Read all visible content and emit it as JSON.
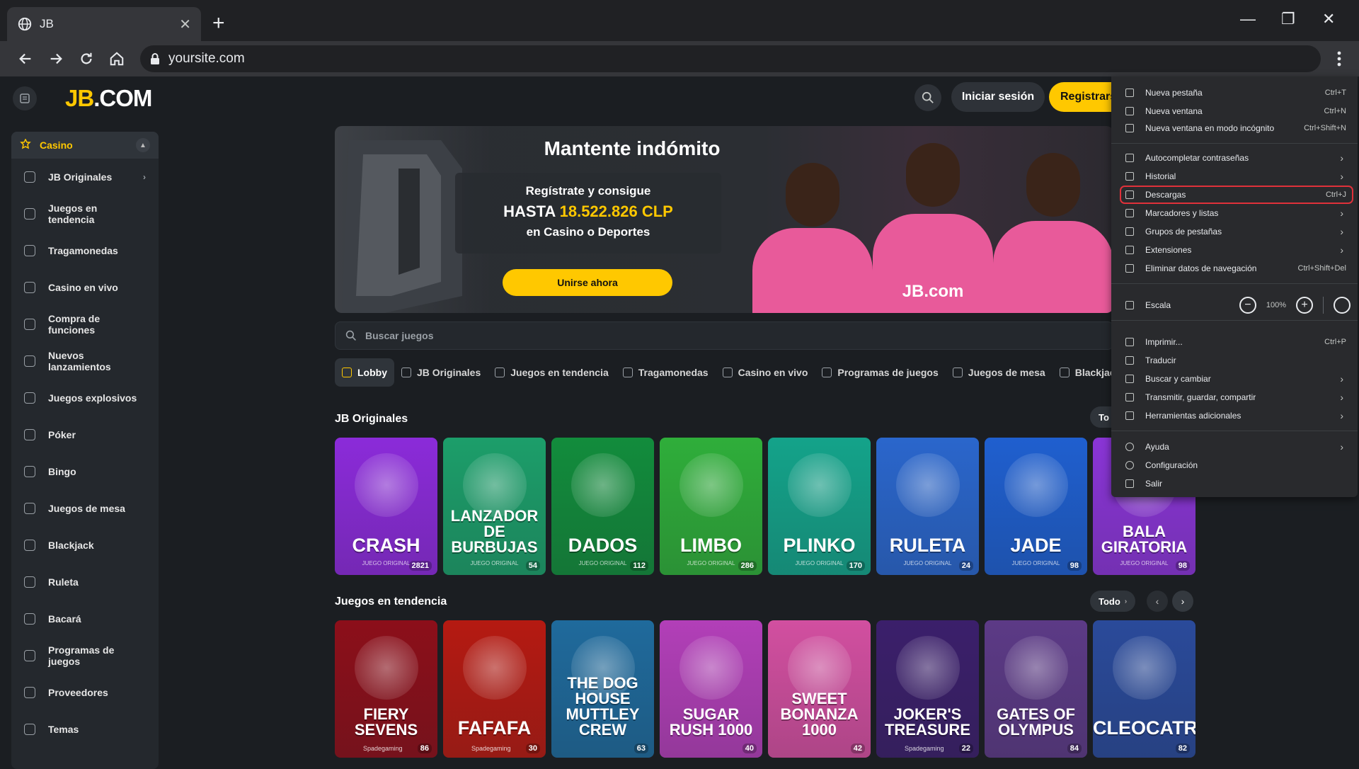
{
  "browser": {
    "tab_title": "JB",
    "url": "yoursite.com"
  },
  "site": {
    "logo_jb": "JB",
    "logo_com": ".COM",
    "login_label": "Iniciar sesión",
    "register_label": "Registrarse"
  },
  "sidebar": {
    "section": "Casino",
    "items": [
      {
        "label": "JB Originales"
      },
      {
        "label": "Juegos en tendencia"
      },
      {
        "label": "Tragamonedas"
      },
      {
        "label": "Casino en vivo"
      },
      {
        "label": "Compra de funciones"
      },
      {
        "label": "Nuevos lanzamientos"
      },
      {
        "label": "Juegos explosivos"
      },
      {
        "label": "Póker"
      },
      {
        "label": "Bingo"
      },
      {
        "label": "Juegos de mesa"
      },
      {
        "label": "Blackjack"
      },
      {
        "label": "Ruleta"
      },
      {
        "label": "Bacará"
      },
      {
        "label": "Programas de juegos"
      },
      {
        "label": "Proveedores"
      },
      {
        "label": "Temas"
      }
    ]
  },
  "hero": {
    "title": "Mantente indómito",
    "line1": "Regístrate y consigue",
    "line2_prefix": "HASTA",
    "line2_amount": "18.522.826 CLP",
    "line3": "en Casino o Deportes",
    "cta": "Unirse ahora",
    "jersey_brand": "JB.com"
  },
  "search": {
    "placeholder": "Buscar juegos"
  },
  "categories": [
    {
      "label": "Lobby"
    },
    {
      "label": "JB Originales"
    },
    {
      "label": "Juegos en tendencia"
    },
    {
      "label": "Tragamonedas"
    },
    {
      "label": "Casino en vivo"
    },
    {
      "label": "Programas de juegos"
    },
    {
      "label": "Juegos de mesa"
    },
    {
      "label": "Blackjack"
    }
  ],
  "originals": {
    "title": "JB Originales",
    "todo_label": "To",
    "subtitle": "JUEGO ORIGINAL",
    "games": [
      {
        "name": "CRASH",
        "count": "2821",
        "color": "#8b2bd9"
      },
      {
        "name": "LANZADOR DE BURBUJAS",
        "count": "54",
        "color": "#1c9e6a"
      },
      {
        "name": "DADOS",
        "count": "112",
        "color": "#128c3c"
      },
      {
        "name": "LIMBO",
        "count": "286",
        "color": "#2fae3a"
      },
      {
        "name": "PLINKO",
        "count": "170",
        "color": "#14a38a"
      },
      {
        "name": "RULETA",
        "count": "24",
        "color": "#2a66cc"
      },
      {
        "name": "JADE",
        "count": "98",
        "color": "#1f5fcf"
      },
      {
        "name": "BALA GIRATORIA",
        "count": "98",
        "color": "#8a35d6"
      }
    ]
  },
  "trending": {
    "title": "Juegos en tendencia",
    "todo_label": "Todo",
    "games": [
      {
        "name": "FIERY SEVENS",
        "provider": "Spadegaming",
        "count": "86",
        "color": "#8c0f1a"
      },
      {
        "name": "FAFAFA",
        "provider": "Spadegaming",
        "count": "30",
        "color": "#b51a12"
      },
      {
        "name": "THE DOG HOUSE MUTTLEY CREW",
        "provider": "",
        "count": "63",
        "color": "#1f6a9c"
      },
      {
        "name": "SUGAR RUSH 1000",
        "provider": "",
        "count": "40",
        "color": "#b23fb8"
      },
      {
        "name": "SWEET BONANZA 1000",
        "provider": "",
        "count": "42",
        "color": "#d24fa0"
      },
      {
        "name": "JOKER'S TREASURE",
        "provider": "Spadegaming",
        "count": "22",
        "color": "#3b1f6b"
      },
      {
        "name": "GATES OF OLYMPUS",
        "provider": "",
        "count": "84",
        "color": "#5c3a86"
      },
      {
        "name": "CLEOCATRA",
        "provider": "",
        "count": "82",
        "color": "#2a4a9a"
      }
    ]
  },
  "chrome_menu": {
    "new_tab": "Nueva pestaña",
    "new_tab_sc": "Ctrl+T",
    "new_window": "Nueva ventana",
    "new_window_sc": "Ctrl+N",
    "incognito": "Nueva ventana en modo incógnito",
    "incognito_sc": "Ctrl+Shift+N",
    "passwords": "Autocompletar contraseñas",
    "history": "Historial",
    "downloads": "Descargas",
    "downloads_sc": "Ctrl+J",
    "bookmarks": "Marcadores y listas",
    "tab_groups": "Grupos de pestañas",
    "extensions": "Extensiones",
    "clear_data": "Eliminar datos de navegación",
    "clear_data_sc": "Ctrl+Shift+Del",
    "zoom": "Escala",
    "zoom_value": "100%",
    "print": "Imprimir...",
    "print_sc": "Ctrl+P",
    "translate": "Traducir",
    "find": "Buscar y cambiar",
    "cast": "Transmitir, guardar, compartir",
    "more_tools": "Herramientas adicionales",
    "help": "Ayuda",
    "settings": "Configuración",
    "exit": "Salir"
  }
}
